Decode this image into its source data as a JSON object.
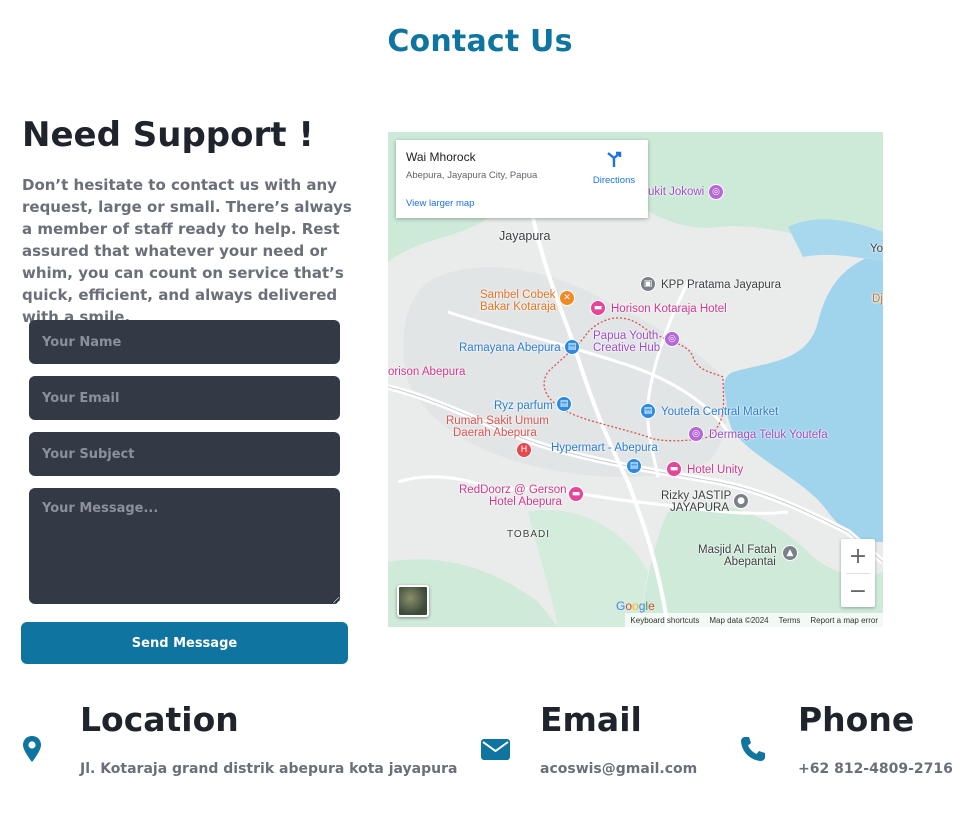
{
  "header": {
    "title": "Contact Us"
  },
  "support": {
    "heading": "Need Support !",
    "text": "Don’t hesitate to contact us with any request, large or small. There’s always a member of staff ready to help. Rest assured that whatever your need or whim, you can count on service that’s quick, efficient, and always delivered with a smile."
  },
  "form": {
    "name_placeholder": "Your Name",
    "email_placeholder": "Your Email",
    "subject_placeholder": "Your Subject",
    "message_placeholder": "Your Message...",
    "submit_label": "Send Message"
  },
  "map": {
    "place_name": "Wai Mhorock",
    "place_address": "Abepura, Jayapura City, Papua",
    "view_larger": "View larger map",
    "directions": "Directions",
    "labels": {
      "jayapura": "Jayapura",
      "jokowi": "ukit Jokowi",
      "kpp": "KPP Pratama Jayapura",
      "sambel_1": "Sambel Cobek",
      "sambel_2": "Bakar Kotaraja",
      "horison_kotaraja": "Horison Kotaraja Hotel",
      "papua_youth_1": "Papua Youth",
      "papua_youth_2": "Creative Hub",
      "ramayana": "Ramayana Abepura",
      "horison_abepura": "orison Abepura",
      "ryz": "Ryz parfum",
      "youtefa_market": "Youtefa Central Market",
      "rsu_1": "Rumah Sakit Umum",
      "rsu_2": "Daerah Abepura",
      "dermaga": "Dermaga Teluk Youtefa",
      "hypermart": "Hypermart - Abepura",
      "hotel_unity": "Hotel Unity",
      "reddoorz_1": "RedDoorz @ Gerson",
      "reddoorz_2": "Hotel Abepura",
      "rizky_1": "Rizky JASTIP",
      "rizky_2": "JAYAPURA",
      "tobadi": "TOBADI",
      "masjid_1": "Masjid Al Fatah",
      "masjid_2": "Abepantai",
      "edge_yo": "Yo",
      "edge_dj": "Dj"
    },
    "zoom_in": "+",
    "zoom_out": "−",
    "google": "Google",
    "attribution": [
      "Keyboard shortcuts",
      "Map data ©2024",
      "Terms",
      "Report a map error"
    ],
    "colors": {
      "water": "#9fd4ec",
      "park": "#c6e8d4",
      "land": "#e8ecea",
      "road": "#ffffff",
      "boundary": "#d9534f"
    }
  },
  "contacts": {
    "location": {
      "title": "Location",
      "value": "Jl. Kotaraja grand distrik abepura kota jayapura",
      "icon": "map-pin-icon"
    },
    "email": {
      "title": "Email",
      "value": "acoswis@gmail.com",
      "icon": "envelope-icon"
    },
    "phone": {
      "title": "Phone",
      "value": "+62 812-4809-2716",
      "icon": "phone-icon"
    }
  },
  "colors": {
    "accent": "#0f74a0",
    "input_bg": "#333a45",
    "heading": "#1f242c",
    "muted": "#6b6f7a"
  }
}
